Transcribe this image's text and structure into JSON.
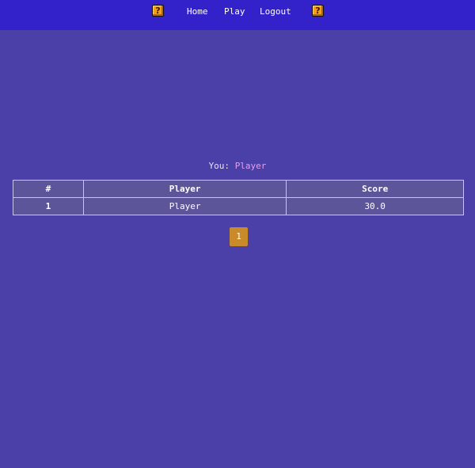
{
  "nav": {
    "left_icon": "question-block-icon",
    "right_icon": "question-block-icon",
    "icon_glyph": "?",
    "links": [
      {
        "label": "Home"
      },
      {
        "label": "Play"
      },
      {
        "label": "Logout"
      }
    ]
  },
  "user": {
    "prefix": "You:",
    "name": "Player"
  },
  "leaderboard": {
    "headers": [
      "#",
      "Player",
      "Score"
    ],
    "rows": [
      {
        "rank": "1",
        "player": "Player",
        "score": "30.0"
      }
    ]
  },
  "pagination": {
    "current_page": "1"
  },
  "colors": {
    "background": "#4b3fa8",
    "topbar": "#3322c9",
    "accent_name": "#e6a0ea",
    "pager": "#c98a2a"
  }
}
